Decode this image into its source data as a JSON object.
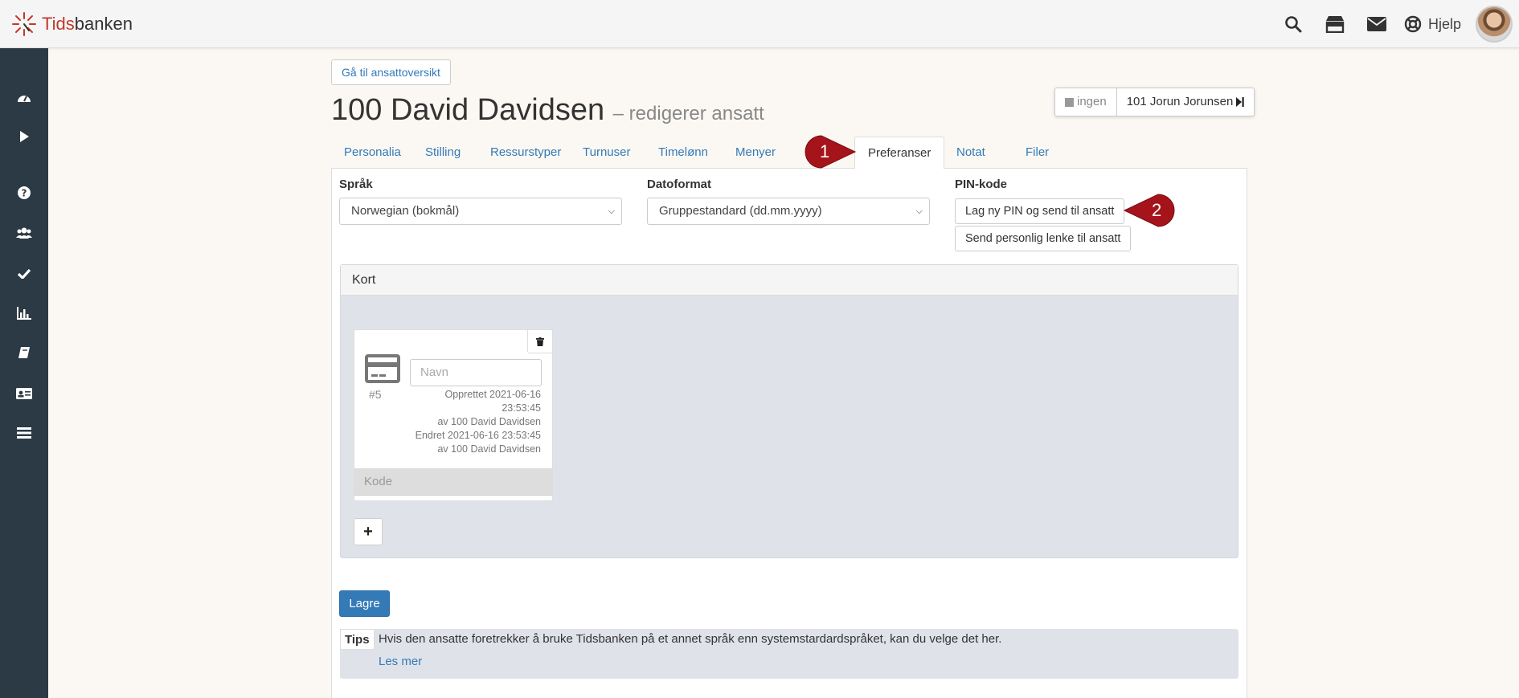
{
  "header": {
    "logo_part1": "Tids",
    "logo_part2": "banken",
    "icons": [
      "search-icon",
      "store-icon",
      "envelope-icon",
      "lifebuoy-icon"
    ],
    "help_label": "Hjelp"
  },
  "sidebar": {
    "icons": [
      "dashboard-icon",
      "play-icon",
      "question-icon",
      "users-icon",
      "check-icon",
      "chart-icon",
      "book-icon",
      "id-card-icon",
      "list-icon"
    ]
  },
  "page": {
    "back_button": "Gå til ansattoversikt",
    "title": "100 David Davidsen",
    "subtitle": "– redigerer ansatt",
    "nav_prev": "ingen",
    "nav_next": "101 Jorun Jorunsen"
  },
  "tabs": [
    "Personalia",
    "Stilling",
    "Ressurstyper",
    "Turnuser",
    "Timelønn",
    "Menyer",
    "Preferanser",
    "Notat",
    "Filer"
  ],
  "active_tab": "Preferanser",
  "form": {
    "language_label": "Språk",
    "language_value": "Norwegian (bokmål)",
    "date_label": "Datoformat",
    "date_value": "Gruppestandard (dd.mm.yyyy)",
    "pin_label": "PIN-kode",
    "pin_button": "Lag ny PIN og send til ansatt",
    "link_button": "Send personlig lenke til ansatt"
  },
  "kort": {
    "heading": "Kort",
    "card": {
      "number": "#5",
      "name_placeholder": "Navn",
      "meta_lines": [
        "Opprettet 2021-06-16",
        "23:53:45",
        "av 100 David Davidsen",
        "Endret 2021-06-16 23:53:45",
        "av 100 David Davidsen"
      ],
      "code_placeholder": "Kode"
    },
    "add_label": "+"
  },
  "save_button": "Lagre",
  "tips": {
    "label": "Tips",
    "text": "Hvis den ansatte foretrekker å bruke Tidsbanken på et annet språk enn systemstardardspråket, kan du velge det her.",
    "link": "Les mer"
  },
  "annotations": [
    "1",
    "2"
  ],
  "colors": {
    "sidebar": "#2b3a45",
    "link": "#337ab7",
    "primary_button": "#337ab7",
    "marker": "#a5141b"
  }
}
